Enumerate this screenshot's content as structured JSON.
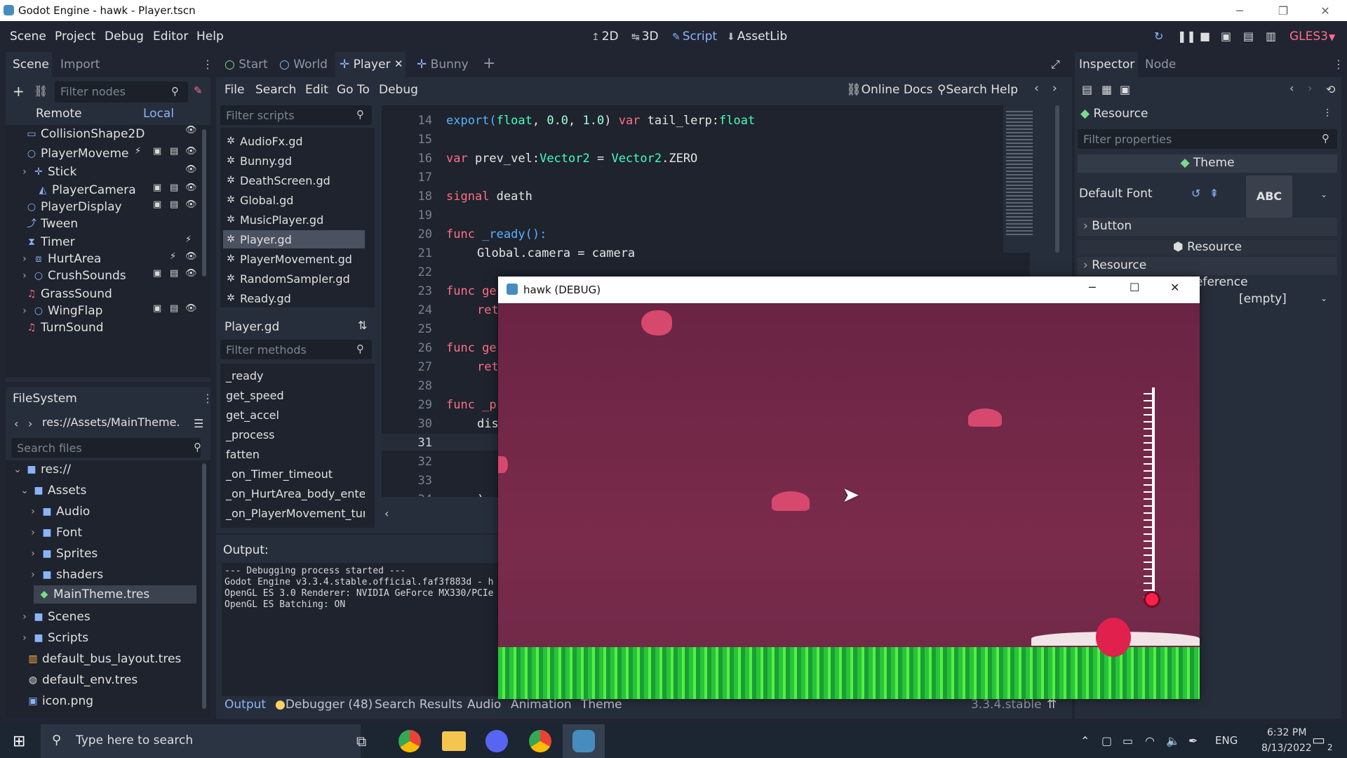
{
  "window_title": "Godot Engine - hawk - Player.tscn",
  "menu": [
    "Scene",
    "Project",
    "Debug",
    "Editor",
    "Help"
  ],
  "workspaces": [
    "2D",
    "3D",
    "Script",
    "AssetLib"
  ],
  "renderer": "GLES3",
  "scene_dock": {
    "tabs": [
      "Scene",
      "Import"
    ],
    "filter_placeholder": "Filter nodes",
    "remote": "Remote",
    "local": "Local",
    "nodes": [
      "CollisionShape2D",
      "PlayerMoveme",
      "Stick",
      "PlayerCamera",
      "PlayerDisplay",
      "Tween",
      "Timer",
      "HurtArea",
      "CrushSounds",
      "GrassSound",
      "WingFlap",
      "TurnSound"
    ]
  },
  "filesystem": {
    "title": "FileSystem",
    "path": "res://Assets/MainTheme.",
    "search_placeholder": "Search files",
    "items": [
      "res://",
      "Assets",
      "Audio",
      "Font",
      "Sprites",
      "shaders",
      "MainTheme.tres",
      "Scenes",
      "Scripts",
      "default_bus_layout.tres",
      "default_env.tres",
      "icon.png"
    ]
  },
  "editor_tabs": [
    "Start",
    "World",
    "Player",
    "Bunny"
  ],
  "script_menu": [
    "File",
    "Search",
    "Edit",
    "Go To",
    "Debug"
  ],
  "online_docs": "Online Docs",
  "search_help": "Search Help",
  "scripts_filter": "Filter scripts",
  "scripts": [
    "AudioFx.gd",
    "Bunny.gd",
    "DeathScreen.gd",
    "Global.gd",
    "MusicPlayer.gd",
    "Player.gd",
    "PlayerMovement.gd",
    "RandomSampler.gd",
    "Ready.gd"
  ],
  "current_script": "Player.gd",
  "methods_filter": "Filter methods",
  "methods": [
    "_ready",
    "get_speed",
    "get_accel",
    "_process",
    "fatten",
    "_on_Timer_timeout",
    "_on_HurtArea_body_entere",
    "_on_PlayerMovement_turn"
  ],
  "line_numbers": [
    "14",
    "15",
    "16",
    "17",
    "18",
    "19",
    "20",
    "21",
    "22",
    "23",
    "24",
    "25",
    "26",
    "27",
    "28",
    "29",
    "30",
    "31",
    "32",
    "33",
    "34"
  ],
  "code": {
    "l14": [
      "export(",
      "float",
      ", ",
      "0.0",
      ", ",
      "1.0",
      ") ",
      "var",
      " tail_lerp:",
      "float"
    ],
    "l16": [
      "var",
      " prev_vel:",
      "Vector2",
      " = ",
      "Vector2",
      ".ZERO"
    ],
    "l18": [
      "signal",
      " death"
    ],
    "l20": [
      "func",
      " _ready():"
    ],
    "l21": [
      "Global.camera = camera"
    ],
    "l23": "func ge",
    "l24": "ret",
    "l26": "func ge",
    "l27": "ret",
    "l29": "func _p",
    "l30": "dis",
    "l34": ")"
  },
  "output": {
    "label": "Output:",
    "lines": [
      "--- Debugging process started ---",
      "Godot Engine v3.3.4.stable.official.faf3f883d - h",
      "OpenGL ES 3.0 Renderer: NVIDIA GeForce MX330/PCIe",
      "OpenGL ES Batching: ON"
    ]
  },
  "bottom_tabs": [
    "Output",
    "Debugger (48)",
    "Search Results",
    "Audio",
    "Animation",
    "Theme"
  ],
  "version": "3.3.4.stable",
  "inspector": {
    "tabs": [
      "Inspector",
      "Node"
    ],
    "resource": "Resource",
    "filter_placeholder": "Filter properties",
    "theme": "Theme",
    "default_font": "Default Font",
    "abc": "ABC",
    "button": "Button",
    "resource_header": "Resource",
    "reference": "eference",
    "empty": "[empty]"
  },
  "game_window": {
    "title": "hawk (DEBUG)"
  },
  "taskbar": {
    "search": "Type here to search",
    "lang": "ENG",
    "time": "6:32 PM",
    "date": "8/13/2022",
    "notifications": "2"
  }
}
